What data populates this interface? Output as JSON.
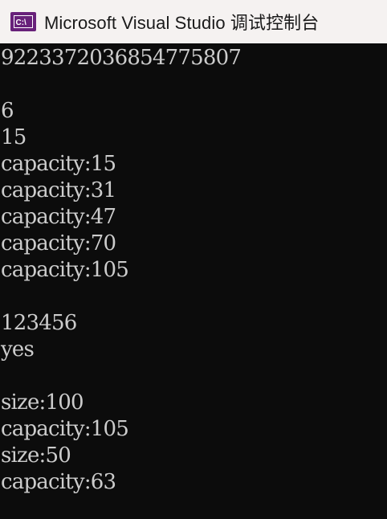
{
  "window": {
    "title": "Microsoft Visual Studio 调试控制台",
    "icon": "visual-studio-console-icon",
    "titlebar_color": "#f5f2f1",
    "background_color": "#0c0c0c",
    "text_color": "#cccccc"
  },
  "console": {
    "lines": [
      "9223372036854775807",
      "",
      "6",
      "15",
      "capacity:15",
      "capacity:31",
      "capacity:47",
      "capacity:70",
      "capacity:105",
      "",
      "123456",
      "yes",
      "",
      "size:100",
      "capacity:105",
      "size:50",
      "capacity:63"
    ]
  }
}
